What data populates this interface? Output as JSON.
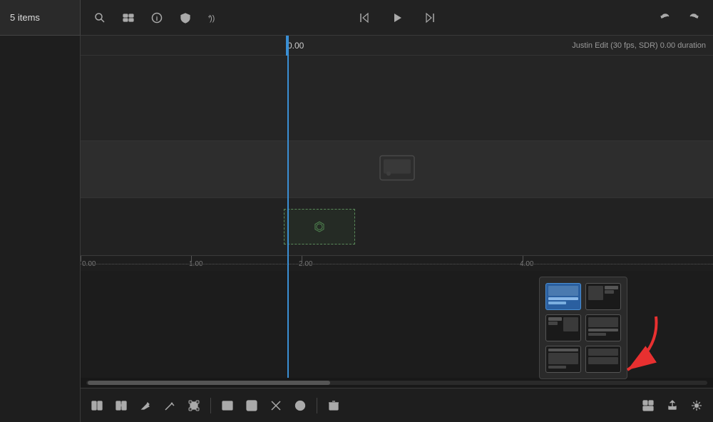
{
  "header": {
    "items_label": "5 items",
    "timecode": "0.00",
    "edit_info": "Justin Edit (30 fps, SDR)  0.00 duration"
  },
  "toolbar": {
    "search_icon": "search",
    "clip_view_icon": "clip-view",
    "info_icon": "info",
    "shield_icon": "shield",
    "add_audio_icon": "add-audio",
    "undo_icon": "undo",
    "redo_icon": "redo",
    "skip_back_icon": "skip-back",
    "play_icon": "play",
    "skip_forward_icon": "skip-forward"
  },
  "timeline": {
    "ruler_marks": [
      {
        "label": "0.00",
        "pos": 0
      },
      {
        "label": "1.00",
        "pos": 155
      },
      {
        "label": "2.00",
        "pos": 310
      },
      {
        "label": "4.00",
        "pos": 620
      }
    ],
    "playhead_position": "0.00"
  },
  "grid_popup": {
    "items": [
      {
        "id": 1,
        "active": true,
        "type": "text-image"
      },
      {
        "id": 2,
        "active": false,
        "type": "image-text"
      },
      {
        "id": 3,
        "active": false,
        "type": "image-text-2"
      },
      {
        "id": 4,
        "active": false,
        "type": "text-image-2"
      },
      {
        "id": 5,
        "active": false,
        "type": "text-3"
      },
      {
        "id": 6,
        "active": false,
        "type": "image-3"
      }
    ]
  },
  "bottom_toolbar": {
    "buttons": [
      "clip-view",
      "add-clip",
      "edit",
      "blade",
      "transform",
      "titles",
      "check",
      "cut",
      "add",
      "delete"
    ],
    "right_buttons": [
      "layout",
      "share",
      "settings"
    ]
  }
}
